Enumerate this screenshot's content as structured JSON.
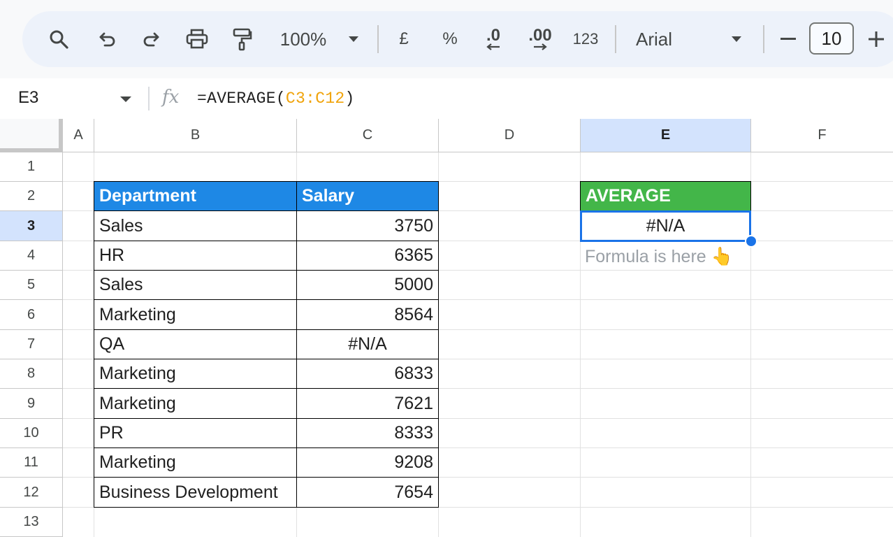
{
  "toolbar": {
    "zoom": "100%",
    "currency": "£",
    "percent": "%",
    "decrease_decimals": ".0",
    "increase_decimals": ".00",
    "more_formats": "123",
    "font": "Arial",
    "font_size": "10",
    "minus": "−",
    "plus": "+"
  },
  "formula_bar": {
    "name_box": "E3",
    "fx": "fx",
    "formula_prefix": "=AVERAGE(",
    "formula_ref": "C3:C12",
    "formula_suffix": ")"
  },
  "columns": [
    "A",
    "B",
    "C",
    "D",
    "E",
    "F"
  ],
  "selected_column": "E",
  "rows": [
    "1",
    "2",
    "3",
    "4",
    "5",
    "6",
    "7",
    "8",
    "9",
    "10",
    "11",
    "12",
    "13"
  ],
  "selected_row": "3",
  "table": {
    "headers": [
      "Department",
      "Salary"
    ],
    "rows": [
      {
        "department": "Sales",
        "salary": "3750"
      },
      {
        "department": "HR",
        "salary": "6365"
      },
      {
        "department": "Sales",
        "salary": "5000"
      },
      {
        "department": "Marketing",
        "salary": "8564"
      },
      {
        "department": "QA",
        "salary": "#N/A"
      },
      {
        "department": "Marketing",
        "salary": "6833"
      },
      {
        "department": "Marketing",
        "salary": "7621"
      },
      {
        "department": "PR",
        "salary": "8333"
      },
      {
        "department": "Marketing",
        "salary": "9208"
      },
      {
        "department": "Business Development",
        "salary": "7654"
      }
    ]
  },
  "average": {
    "header": "AVERAGE",
    "result": "#N/A",
    "note": "Formula is here 👆"
  },
  "colors": {
    "table_header": "#1e88e5",
    "average_header": "#43b649",
    "selection": "#1a73e8",
    "formula_ref": "#f0a30a"
  }
}
